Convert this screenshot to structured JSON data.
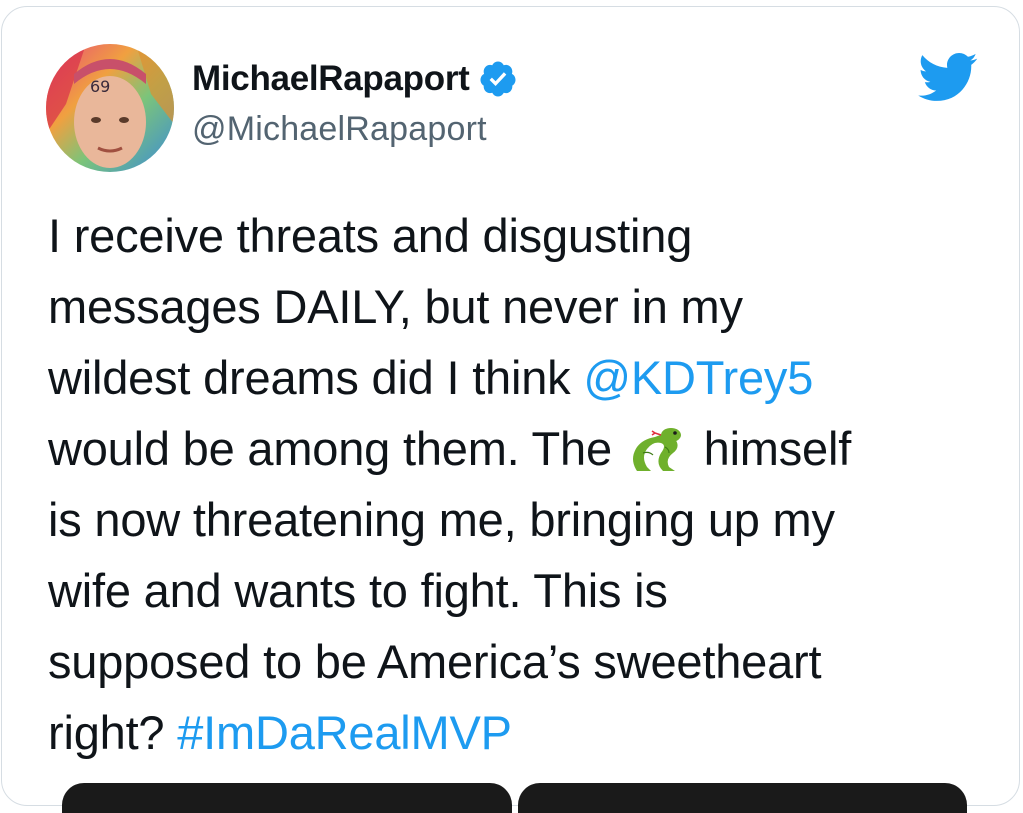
{
  "tweet": {
    "author": {
      "display_name": "MichaelRapaport",
      "handle": "@MichaelRapaport",
      "verified": true,
      "avatar_icon": "avatar"
    },
    "logo_icon": "twitter-bird-icon",
    "text": {
      "line1": "I receive threats and disgusting",
      "line2": "messages DAILY, but never in my",
      "line3_pre": "wildest dreams did I think ",
      "mention": "@KDTrey5",
      "line4_pre": "would be among them. The ",
      "emoji": "snake-emoji",
      "line4_post": " himself",
      "line5": "is now threatening me, bringing up my",
      "line6": "wife and wants to fight. This is",
      "line7": "supposed to be America’s sweetheart",
      "line8_pre": "right? ",
      "hashtag": "#ImDaRealMVP"
    },
    "colors": {
      "link": "#1d9bf0",
      "text": "#0f1419",
      "secondary": "#536471",
      "verified": "#1d9bf0"
    }
  }
}
